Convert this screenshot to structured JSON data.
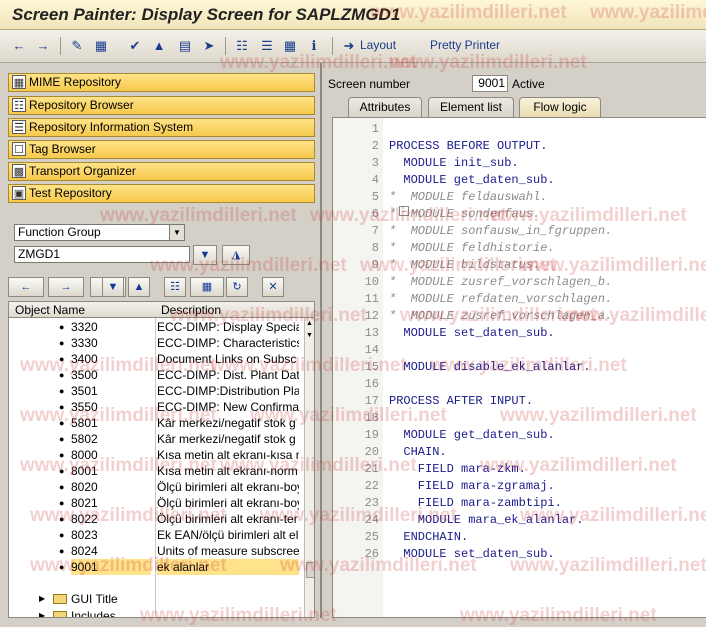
{
  "title": "Screen Painter: Display Screen for SAPLZMGD1",
  "toolbar": {
    "layout_label": "Layout",
    "pretty_printer_label": "Pretty Printer"
  },
  "nav": [
    {
      "label": "MIME Repository",
      "icon": "mime-icon"
    },
    {
      "label": "Repository Browser",
      "icon": "browser-icon"
    },
    {
      "label": "Repository Information System",
      "icon": "info-system-icon"
    },
    {
      "label": "Tag Browser",
      "icon": "tag-icon"
    },
    {
      "label": "Transport Organizer",
      "icon": "transport-icon"
    },
    {
      "label": "Test Repository",
      "icon": "test-icon"
    }
  ],
  "object_type": "Function Group",
  "object_name": "ZMGD1",
  "tree": {
    "col_object": "Object Name",
    "col_desc": "Description",
    "rows": [
      {
        "name": "3320",
        "desc": "ECC-DIMP: Display Speciali"
      },
      {
        "name": "3330",
        "desc": "ECC-DIMP: Characteristics"
      },
      {
        "name": "3400",
        "desc": "Document Links on Subsc"
      },
      {
        "name": "3500",
        "desc": "ECC-DIMP: Dist. Plant Data"
      },
      {
        "name": "3501",
        "desc": "ECC-DIMP:Distribution Plar"
      },
      {
        "name": "3550",
        "desc": "ECC-DIMP: New Confirmati"
      },
      {
        "name": "5801",
        "desc": "Kâr merkezi/negatif stok g"
      },
      {
        "name": "5802",
        "desc": "Kâr merkezi/negatif stok g"
      },
      {
        "name": "8000",
        "desc": "Kısa metin alt ekranı-kısa n"
      },
      {
        "name": "8001",
        "desc": "Kısa metin alt ekranı-norm"
      },
      {
        "name": "8020",
        "desc": "Ölçü birimleri alt ekranı-boy"
      },
      {
        "name": "8021",
        "desc": "Ölçü birimleri alt ekranı-boy"
      },
      {
        "name": "8022",
        "desc": "Ölçü birimleri alt ekranı-ter"
      },
      {
        "name": "8023",
        "desc": "Ek EAN/ölçü birimleri alt el"
      },
      {
        "name": "8024",
        "desc": "Units of measure subscree"
      },
      {
        "name": "9001",
        "desc": "ek alanlar"
      }
    ],
    "folders": [
      "GUI Title",
      "Includes"
    ]
  },
  "screen_number_label": "Screen number",
  "screen_number": "9001",
  "status": "Active",
  "tabs": [
    "Attributes",
    "Element list",
    "Flow logic"
  ],
  "code": [
    {
      "n": "1",
      "t": "",
      "cm": false
    },
    {
      "n": "2",
      "t": "PROCESS BEFORE OUTPUT.",
      "cm": false
    },
    {
      "n": "3",
      "t": "  MODULE init_sub.",
      "cm": false
    },
    {
      "n": "4",
      "t": "  MODULE get_daten_sub.",
      "cm": false
    },
    {
      "n": "5",
      "t": "*  MODULE feldauswahl.",
      "cm": true
    },
    {
      "n": "6",
      "t": "*  MODULE sonderfaus.",
      "cm": true
    },
    {
      "n": "7",
      "t": "*  MODULE sonfausw_in_fgruppen.",
      "cm": true
    },
    {
      "n": "8",
      "t": "*  MODULE feldhistorie.",
      "cm": true
    },
    {
      "n": "9",
      "t": "*  MODULE bildstatus.",
      "cm": true
    },
    {
      "n": "10",
      "t": "*  MODULE zusref_vorschlagen_b.",
      "cm": true
    },
    {
      "n": "11",
      "t": "*  MODULE refdaten_vorschlagen.",
      "cm": true
    },
    {
      "n": "12",
      "t": "*  MODULE zusref_vorschlagen_a.",
      "cm": true
    },
    {
      "n": "13",
      "t": "  MODULE set_daten_sub.",
      "cm": false
    },
    {
      "n": "14",
      "t": "",
      "cm": false
    },
    {
      "n": "15",
      "t": "  MODULE disable_ek_alanlar.",
      "cm": false
    },
    {
      "n": "16",
      "t": "",
      "cm": false
    },
    {
      "n": "17",
      "t": "PROCESS AFTER INPUT.",
      "cm": false
    },
    {
      "n": "18",
      "t": "",
      "cm": false
    },
    {
      "n": "19",
      "t": "  MODULE get_daten_sub.",
      "cm": false
    },
    {
      "n": "20",
      "t": "  CHAIN.",
      "cm": false
    },
    {
      "n": "21",
      "t": "    FIELD mara-zkm.",
      "cm": false
    },
    {
      "n": "22",
      "t": "    FIELD mara-zgramaj.",
      "cm": false
    },
    {
      "n": "23",
      "t": "    FIELD mara-zambtipi.",
      "cm": false
    },
    {
      "n": "24",
      "t": "    MODULE mara_ek_alanlar.",
      "cm": false
    },
    {
      "n": "25",
      "t": "  ENDCHAIN.",
      "cm": false
    },
    {
      "n": "26",
      "t": "  MODULE set_daten_sub.",
      "cm": false
    }
  ],
  "watermark": "www.yazilimdilleri.net"
}
